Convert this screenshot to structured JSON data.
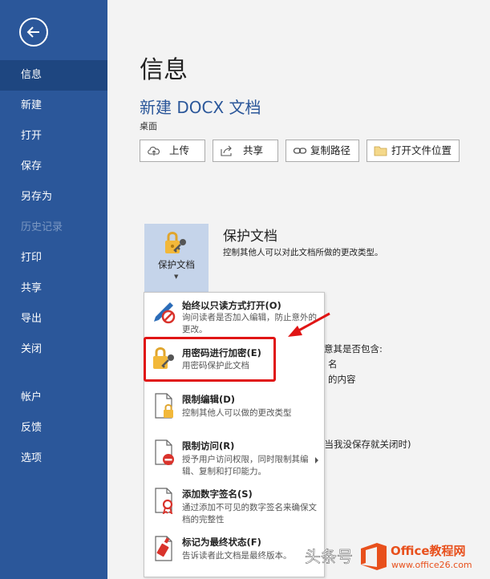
{
  "sidebar": {
    "items": [
      {
        "label": "信息",
        "state": "active"
      },
      {
        "label": "新建",
        "state": "normal"
      },
      {
        "label": "打开",
        "state": "normal"
      },
      {
        "label": "保存",
        "state": "normal"
      },
      {
        "label": "另存为",
        "state": "normal"
      },
      {
        "label": "历史记录",
        "state": "disabled"
      },
      {
        "label": "打印",
        "state": "normal"
      },
      {
        "label": "共享",
        "state": "normal"
      },
      {
        "label": "导出",
        "state": "normal"
      },
      {
        "label": "关闭",
        "state": "normal"
      },
      {
        "label": "帐户",
        "state": "normal"
      },
      {
        "label": "反馈",
        "state": "normal"
      },
      {
        "label": "选项",
        "state": "normal"
      }
    ]
  },
  "main": {
    "page_title": "信息",
    "doc_title": "新建 DOCX 文档",
    "doc_location": "桌面",
    "buttons": {
      "upload": "上传",
      "share": "共享",
      "copy_path": "复制路径",
      "open_location": "打开文件位置"
    }
  },
  "protect": {
    "tile_label": "保护文档",
    "heading": "保护文档",
    "description": "控制其他人可以对此文档所做的更改类型。"
  },
  "background_text": {
    "line1": "意其是否包含:",
    "line2": "名",
    "line3": "的内容",
    "line4": "(当我没保存就关闭时)"
  },
  "dropdown": {
    "items": [
      {
        "title": "始终以只读方式打开(O)",
        "desc": "询问读者是否加入编辑，防止意外的更改。"
      },
      {
        "title": "用密码进行加密(E)",
        "desc": "用密码保护此文档"
      },
      {
        "title": "限制编辑(D)",
        "desc": "控制其他人可以做的更改类型"
      },
      {
        "title": "限制访问(R)",
        "desc": "授予用户访问权限，同时限制其编辑、复制和打印能力。"
      },
      {
        "title": "添加数字签名(S)",
        "desc": "通过添加不可见的数字签名来确保文档的完整性"
      },
      {
        "title": "标记为最终状态(F)",
        "desc": "告诉读者此文档是最终版本。"
      }
    ]
  },
  "watermark": {
    "text1": "头条号",
    "text2": "Office教程网",
    "text3": "www.office26.com"
  },
  "colors": {
    "sidebar": "#2b579a",
    "sidebar_active": "#1e4680",
    "accent": "#2b579a",
    "highlight": "#e01515",
    "tile": "#c5d4ea"
  }
}
